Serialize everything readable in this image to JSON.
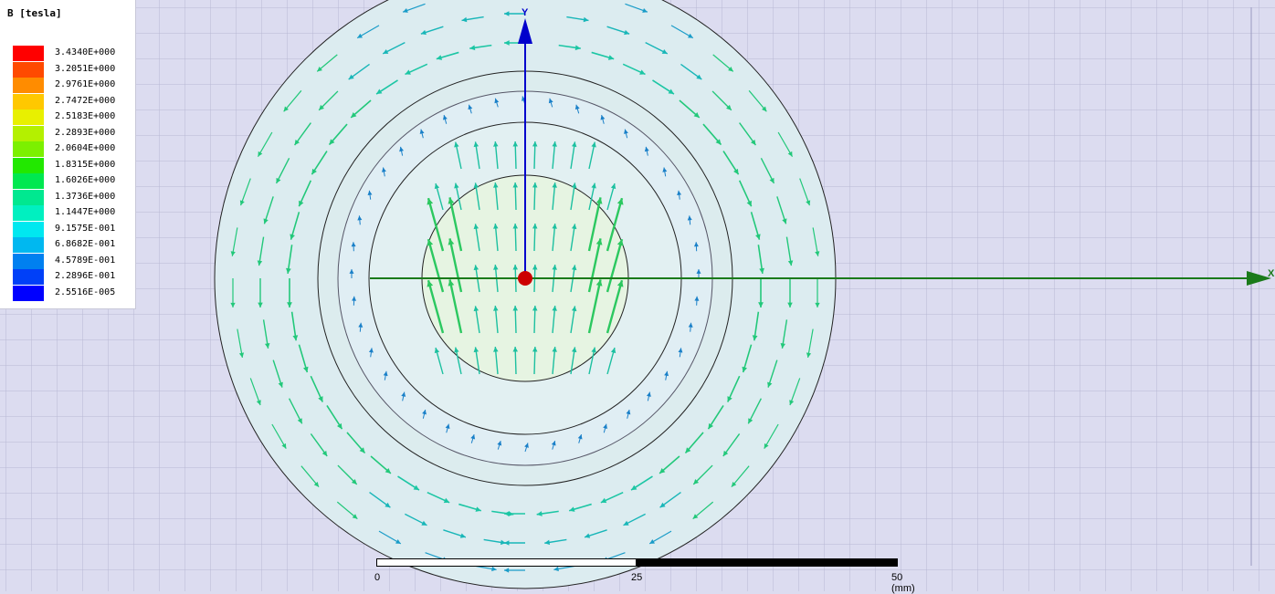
{
  "legend": {
    "title": "B [tesla]",
    "entries": [
      {
        "label": "3.4340E+000",
        "color": "#ff0000"
      },
      {
        "label": "3.2051E+000",
        "color": "#ff4a00"
      },
      {
        "label": "2.9761E+000",
        "color": "#ff8c00"
      },
      {
        "label": "2.7472E+000",
        "color": "#ffc800"
      },
      {
        "label": "2.5183E+000",
        "color": "#e8f000"
      },
      {
        "label": "2.2893E+000",
        "color": "#b4f000"
      },
      {
        "label": "2.0604E+000",
        "color": "#7cf000"
      },
      {
        "label": "1.8315E+000",
        "color": "#22e800"
      },
      {
        "label": "1.6026E+000",
        "color": "#00e850"
      },
      {
        "label": "1.3736E+000",
        "color": "#00e890"
      },
      {
        "label": "1.1447E+000",
        "color": "#00f0c0"
      },
      {
        "label": "9.1575E-001",
        "color": "#00e8f0"
      },
      {
        "label": "6.8682E-001",
        "color": "#00b8f0"
      },
      {
        "label": "4.5789E-001",
        "color": "#0080f0"
      },
      {
        "label": "2.2896E-001",
        "color": "#0040f8"
      },
      {
        "label": "2.5516E-005",
        "color": "#0000ff"
      }
    ]
  },
  "axes": {
    "x_label": "X",
    "y_label": "Y"
  },
  "scale_bar": {
    "ticks": [
      "0",
      "25",
      "50 (mm)"
    ]
  },
  "colors": {
    "background": "#dcdcf0",
    "grid": "#b8b8d4",
    "x_axis": "#1a7a1a",
    "y_axis": "#0000cc",
    "origin": "#cc0000"
  }
}
